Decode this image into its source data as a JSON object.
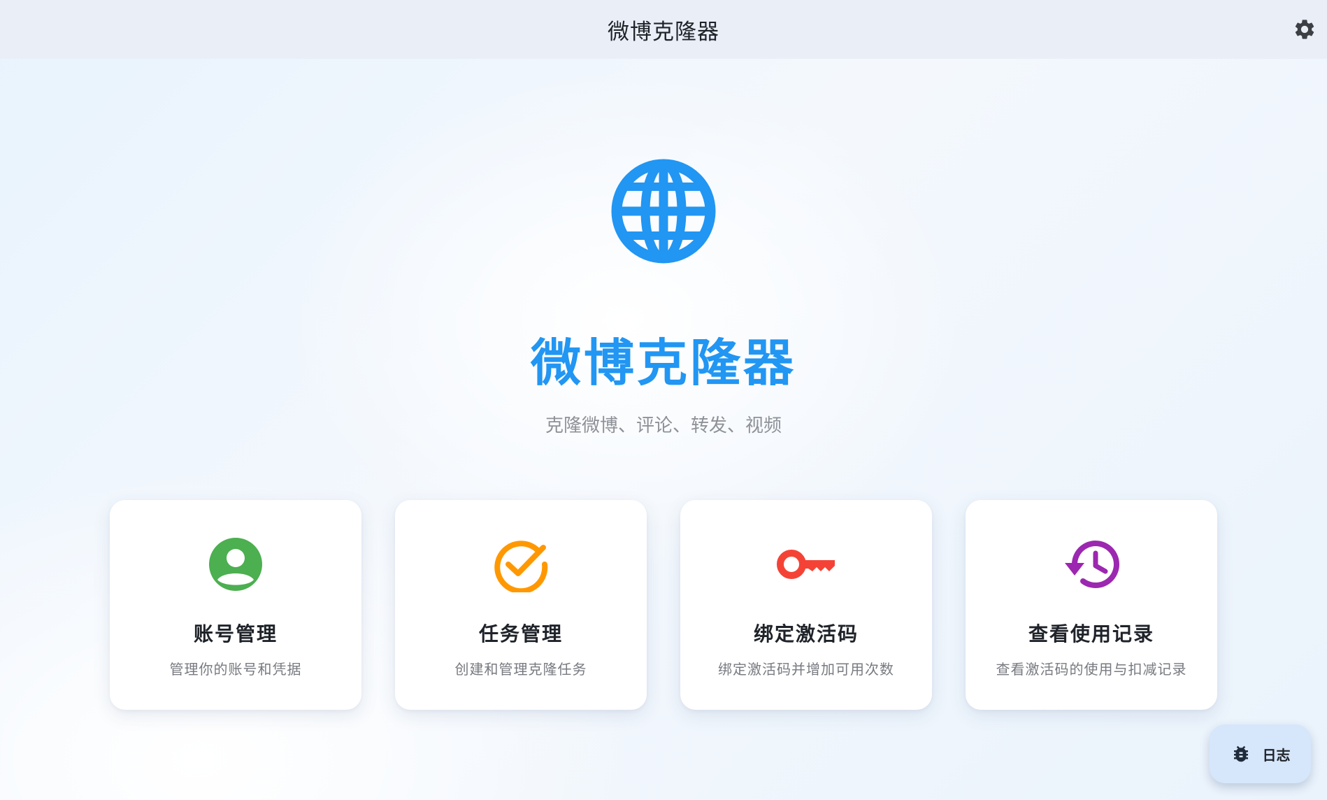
{
  "appbar": {
    "title": "微博克隆器",
    "settings_icon": "gear-icon"
  },
  "hero": {
    "icon": "globe-icon",
    "title": "微博克隆器",
    "subtitle": "克隆微博、评论、转发、视频",
    "accent_color": "#2196f3"
  },
  "cards": [
    {
      "icon": "account-circle-icon",
      "color": "#4caf50",
      "title": "账号管理",
      "description": "管理你的账号和凭据"
    },
    {
      "icon": "check-circle-icon",
      "color": "#ff9800",
      "title": "任务管理",
      "description": "创建和管理克隆任务"
    },
    {
      "icon": "key-icon",
      "color": "#f44336",
      "title": "绑定激活码",
      "description": "绑定激活码并增加可用次数"
    },
    {
      "icon": "history-icon",
      "color": "#9c27b0",
      "title": "查看使用记录",
      "description": "查看激活码的使用与扣减记录"
    }
  ],
  "log_button": {
    "icon": "bug-icon",
    "label": "日志"
  }
}
